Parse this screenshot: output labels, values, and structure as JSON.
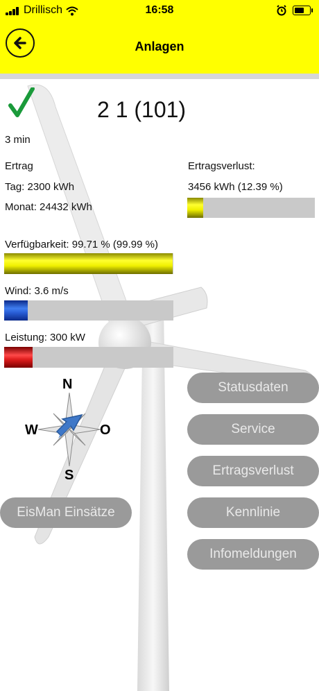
{
  "status_bar": {
    "carrier": "Drillisch",
    "time": "16:58"
  },
  "header": {
    "title": "Anlagen"
  },
  "plant": {
    "id": "2 1 (101)",
    "age": "3 min"
  },
  "ertrag": {
    "label": "Ertrag",
    "tag": "Tag: 2300 kWh",
    "monat": "Monat: 24432 kWh"
  },
  "ertragsverlust": {
    "label": "Ertragsverlust:",
    "value": "3456 kWh (12.39 %)",
    "fraction": 0.1239
  },
  "verfuegbarkeit": {
    "label": "Verfügbarkeit: 99.71 % (99.99 %)",
    "fraction": 0.9971
  },
  "wind": {
    "label": "Wind: 3.6 m/s",
    "fraction": 0.14
  },
  "leistung": {
    "label": "Leistung: 300 kW",
    "fraction": 0.17
  },
  "compass": {
    "n": "N",
    "s": "S",
    "w": "W",
    "o": "O"
  },
  "buttons": {
    "statusdaten": "Statusdaten",
    "service": "Service",
    "ertragsverlust": "Ertragsverlust",
    "kennlinie": "Kennlinie",
    "infomeldungen": "Infomeldungen",
    "eisman": "EisMan Einsätze"
  },
  "colors": {
    "header": "#ffff00",
    "check": "#1a9a3a",
    "button": "#9a9a9a"
  }
}
